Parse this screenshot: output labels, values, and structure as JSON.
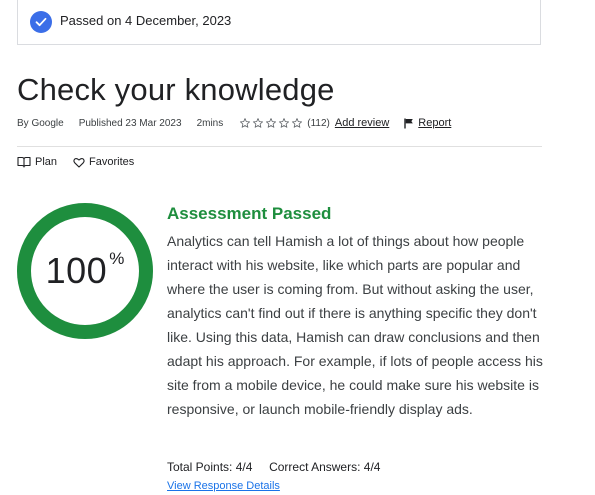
{
  "banner": {
    "text": "Passed on 4 December, 2023"
  },
  "page": {
    "title": "Check your knowledge"
  },
  "meta": {
    "author": "By Google",
    "published": "Published 23 Mar 2023",
    "duration": "2mins",
    "rating_count": "(112)",
    "add_review": "Add review",
    "report": "Report",
    "star_rating": 0
  },
  "actions": {
    "plan": "Plan",
    "favorites": "Favorites"
  },
  "result": {
    "percent": "100",
    "percent_sign": "%",
    "percent_value": 100,
    "title": "Assessment Passed",
    "description": "Analytics can tell Hamish a lot of things about how people interact with his website, like which parts are popular and where the user is coming from. But without asking the user, analytics can't find out if there is anything specific they don't like. Using this data, Hamish can draw conclusions and then adapt his approach. For example, if lots of people access his site from a mobile device, he could make sure his website is responsive, or launch mobile-friendly display ads.",
    "total_points": "Total Points: 4/4",
    "correct_answers": "Correct Answers: 4/4",
    "view_link": "View Response Details"
  },
  "colors": {
    "accent_blue": "#3b6ee8",
    "pass_green": "#1e8e3e",
    "link_blue": "#1a73e8"
  },
  "icons": [
    "check-icon",
    "star-outline-icon",
    "flag-icon",
    "book-icon",
    "heart-outline-icon"
  ]
}
